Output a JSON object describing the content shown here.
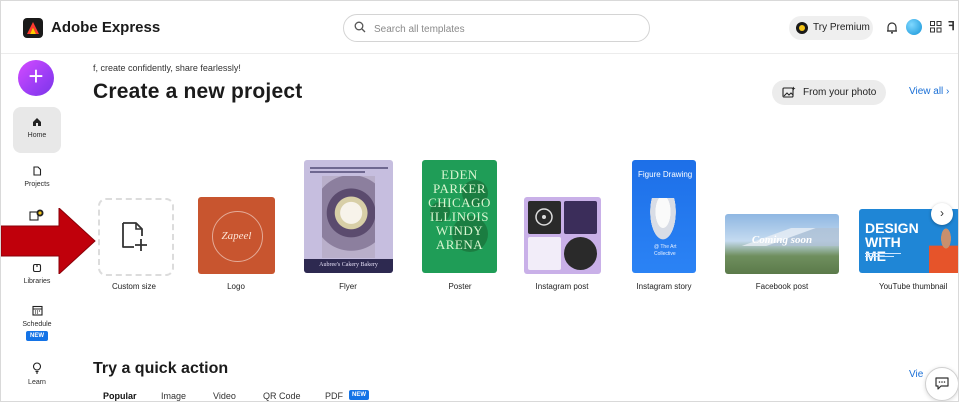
{
  "header": {
    "app_title": "Adobe Express",
    "search_placeholder": "Search all templates",
    "premium_label": "Try Premium"
  },
  "sidebar": {
    "items": [
      {
        "label": "Home"
      },
      {
        "label": "Projects"
      },
      {
        "label": "Libraries"
      },
      {
        "label": "Schedule",
        "badge": "NEW"
      },
      {
        "label": "Learn"
      }
    ]
  },
  "main": {
    "tagline": "f, create confidently, share fearlessly!",
    "heading": "Create a new project",
    "from_photo_label": "From your photo",
    "view_all_label": "View all",
    "cards": [
      {
        "label": "Custom size"
      },
      {
        "label": "Logo",
        "thumb_text": "Zapeel"
      },
      {
        "label": "Flyer",
        "thumb_text": "Aubree's Cakery Bakery"
      },
      {
        "label": "Poster",
        "thumb_text": "EDEN PARKER CHICAGO ILLINOIS WINDY ARENA"
      },
      {
        "label": "Instagram post"
      },
      {
        "label": "Instagram story",
        "thumb_title": "Figure Drawing",
        "thumb_foot": "@ The Art Collective"
      },
      {
        "label": "Facebook post",
        "thumb_text": "Coming soon"
      },
      {
        "label": "YouTube thumbnail",
        "thumb_text": "DESIGN WITH ME"
      }
    ],
    "quick_action_heading": "Try a quick action",
    "quick_tabs": [
      "Popular",
      "Image",
      "Video",
      "QR Code",
      "PDF"
    ],
    "quick_new_badge": "NEW",
    "view_cut": "Vie"
  },
  "colors": {
    "accent": "#1473e6",
    "create_button": "#9b3df5",
    "annotation_arrow": "#c0000b"
  }
}
